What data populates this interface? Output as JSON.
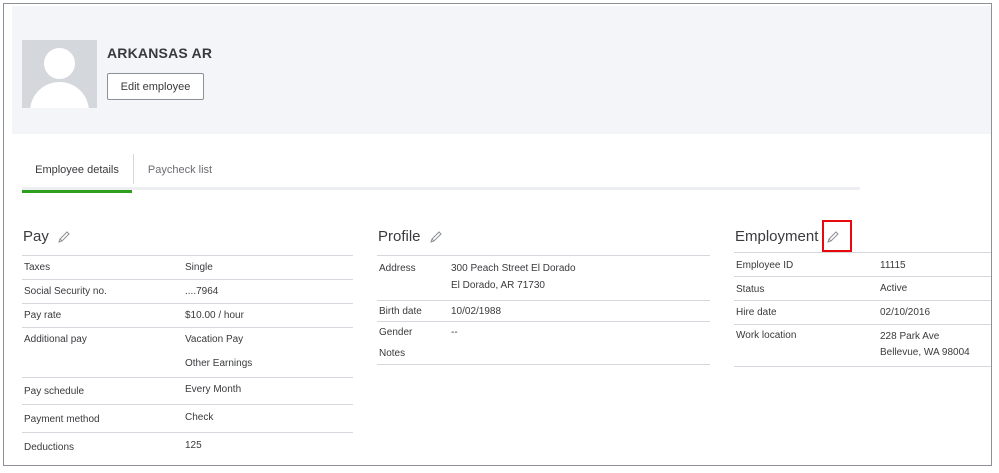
{
  "employee": {
    "name": "ARKANSAS AR",
    "edit_label": "Edit employee"
  },
  "tabs": [
    {
      "label": "Employee details",
      "active": true
    },
    {
      "label": "Paycheck list",
      "active": false
    }
  ],
  "pay": {
    "title": "Pay",
    "rows": [
      {
        "label": "Taxes",
        "value": "Single"
      },
      {
        "label": "Social Security no.",
        "value": "....7964"
      },
      {
        "label": "Pay rate",
        "value": "$10.00 / hour"
      },
      {
        "label": "Additional pay",
        "value": "Vacation Pay",
        "value2": "Other Earnings"
      },
      {
        "label": "Pay schedule",
        "value": "Every Month"
      },
      {
        "label": "Payment method",
        "value": "Check"
      },
      {
        "label": "Deductions",
        "value": "125"
      }
    ]
  },
  "profile": {
    "title": "Profile",
    "rows": [
      {
        "label": "Address",
        "value": "300 Peach Street El Dorado",
        "value2": "El Dorado, AR 71730"
      },
      {
        "label": "Birth date",
        "value": "10/02/1988"
      },
      {
        "label": "Gender",
        "value": "--"
      },
      {
        "label": "Notes",
        "value": ""
      }
    ]
  },
  "employment": {
    "title": "Employment",
    "rows": [
      {
        "label": "Employee ID",
        "value": "11115"
      },
      {
        "label": "Status",
        "value": "Active"
      },
      {
        "label": "Hire date",
        "value": "02/10/2016"
      },
      {
        "label": "Work location",
        "value": "228 Park Ave",
        "value2": "Bellevue, WA 98004"
      }
    ]
  },
  "colors": {
    "accent_green": "#2ca01c",
    "highlight_red": "#e8090d",
    "header_bg": "#f4f5f8"
  },
  "icons": {
    "edit": "pencil-icon",
    "avatar": "person-silhouette"
  }
}
